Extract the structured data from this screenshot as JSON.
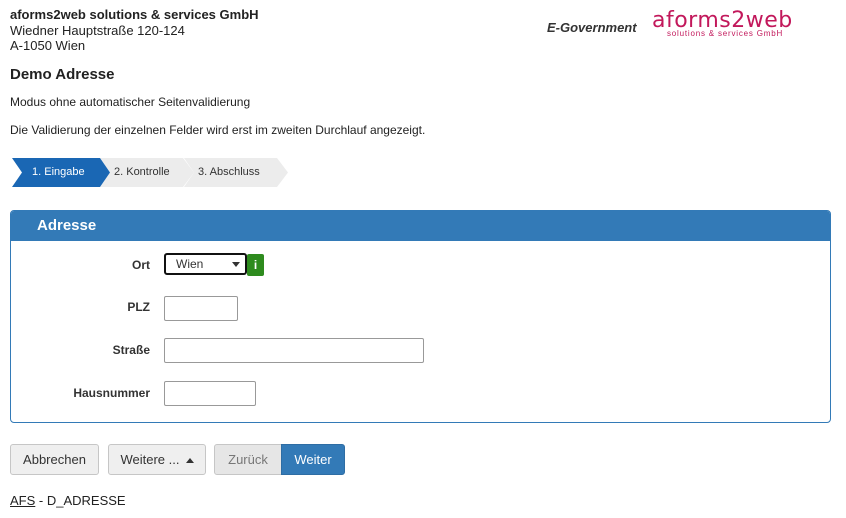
{
  "header": {
    "company_name": "aforms2web solutions & services GmbH",
    "street": "Wiedner Hauptstraße 120-124",
    "city": "A-1050 Wien",
    "egov": "E-Government",
    "logo_text": "aforms2web",
    "logo_sub": "solutions & services GmbH",
    "brand_color": "#c2185b"
  },
  "page": {
    "title": "Demo Adresse",
    "line1": "Modus ohne automatischer Seitenvalidierung",
    "line2": "Die Validierung der einzelnen Felder wird erst im zweiten Durchlauf angezeigt."
  },
  "steps": [
    {
      "label": "1. Eingabe",
      "active": true
    },
    {
      "label": "2. Kontrolle",
      "active": false
    },
    {
      "label": "3. Abschluss",
      "active": false
    }
  ],
  "panel": {
    "title": "Adresse",
    "accent_color": "#337ab7",
    "fields": {
      "ort": {
        "label": "Ort",
        "value": "Wien",
        "info_icon": "i"
      },
      "plz": {
        "label": "PLZ",
        "value": ""
      },
      "strasse": {
        "label": "Straße",
        "value": ""
      },
      "hausnummer": {
        "label": "Hausnummer",
        "value": ""
      }
    }
  },
  "buttons": {
    "cancel": "Abbrechen",
    "more": "Weitere ...",
    "back": "Zurück",
    "next": "Weiter"
  },
  "footer": {
    "link": "AFS",
    "text": " - D_ADRESSE"
  }
}
